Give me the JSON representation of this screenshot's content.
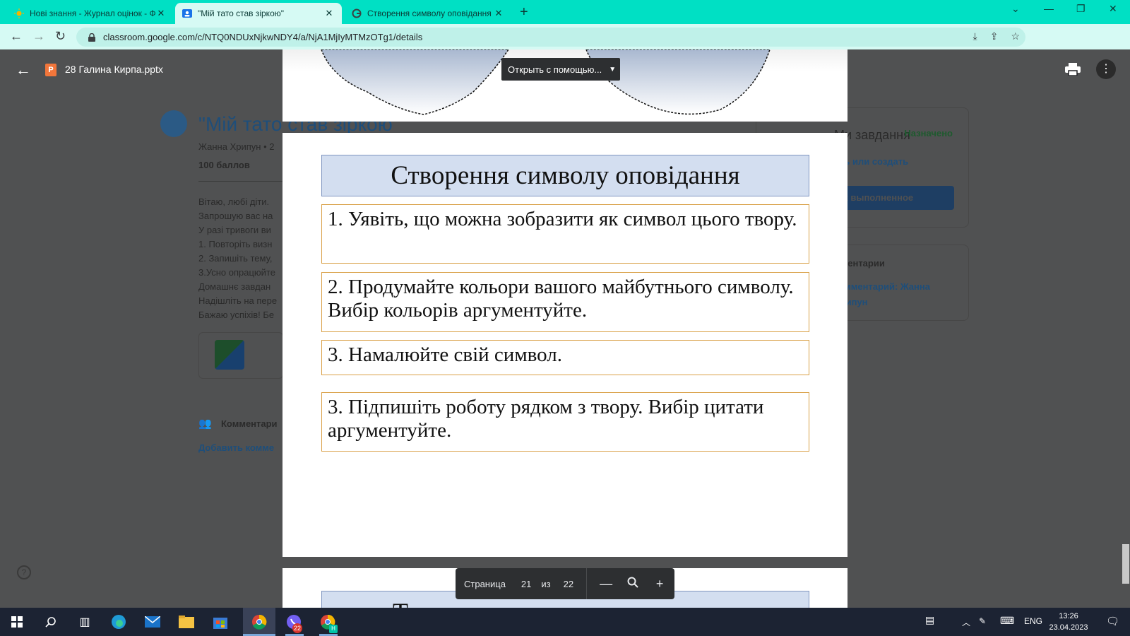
{
  "browser": {
    "tabs": [
      {
        "title": "Нові знання - Журнал оцінок - Ф",
        "active": false
      },
      {
        "title": "\"Мій тато став зіркою\"",
        "active": true
      },
      {
        "title": "Створення символу оповідання",
        "active": false
      }
    ],
    "url": "classroom.google.com/c/NTQ0NDUxNjkwNDY4/a/NjA1MjIyMTMzOTg1/details",
    "accent_color": "#00e0c4"
  },
  "background_page": {
    "title": "\"Мій тато став зіркою\"",
    "author_line": "Жанна Хрипун • 2",
    "points": "100 баллов",
    "body_lines": [
      "Вітаю, любі діти.",
      "Запрошую вас на",
      "У разі тривоги ви",
      "1. Повторіть визн",
      "2. Запишіть тему,",
      "3.Усно опрацюйте",
      "Домашнє завдан",
      "Надішліть на пере",
      "Бажаю успіхів! Бе"
    ],
    "comments_label": "Комментари",
    "add_comment": "Добавить комме",
    "card_title": "Ми завдання",
    "card_status": "Назначено",
    "card_add": "ить или создать",
    "card_button": "ак выполненное",
    "private_comments": "мментарии",
    "private_comment_link": "комментарий: Жанна Хрипун",
    "help_icon": "?"
  },
  "viewer": {
    "file_name": "28 Галина Кирпа.pptx",
    "open_with": "Открыть с помощью...",
    "slide": {
      "title": "Створення символу оповідання",
      "items": [
        "1. Уявіть, що можна зобразити як символ цього твору.",
        "2. Продумайте кольори вашого майбутнього символу. Вибір кольорів аргументуйте.",
        "3. Намалюйте свій символ.",
        "3. Підпишіть роботу рядком з твору. Вибір цитати аргументуйте."
      ]
    },
    "next_slide_title_fragment": "Т",
    "pager": {
      "label": "Страница",
      "current": "21",
      "of": "из",
      "total": "22"
    }
  },
  "taskbar": {
    "language": "ENG",
    "time": "13:26",
    "date": "23.04.2023",
    "viber_badge": "22",
    "chrome_badge": "H"
  }
}
